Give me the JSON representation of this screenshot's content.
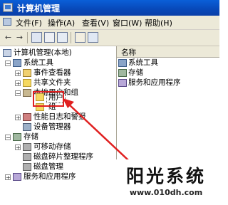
{
  "window": {
    "title": "计算机管理"
  },
  "menu": {
    "items": [
      "文件(F)",
      "操作(A)",
      "查看(V)",
      "窗口(W)",
      "帮助(H)"
    ]
  },
  "toolbar": {
    "back": "←",
    "forward": "→"
  },
  "tree": {
    "root": "计算机管理(本地)",
    "system_tools": "系统工具",
    "event_viewer": "事件查看器",
    "shared_folders": "共享文件夹",
    "local_users_groups": "本地用户和组",
    "users": "用户",
    "groups": "组",
    "perf_logs": "性能日志和警报",
    "device_manager": "设备管理器",
    "storage": "存储",
    "removable_storage": "可移动存储",
    "defrag": "磁盘碎片整理程序",
    "disk_mgmt": "磁盘管理",
    "services_apps": "服务和应用程序"
  },
  "list": {
    "column_name": "名称",
    "items": [
      "系统工具",
      "存储",
      "服务和应用程序"
    ]
  },
  "watermark": {
    "title": "阳光系统",
    "url": "www.010dh.com"
  },
  "colors": {
    "titlebar": "#0a5fd8",
    "highlight": "#e02020"
  }
}
